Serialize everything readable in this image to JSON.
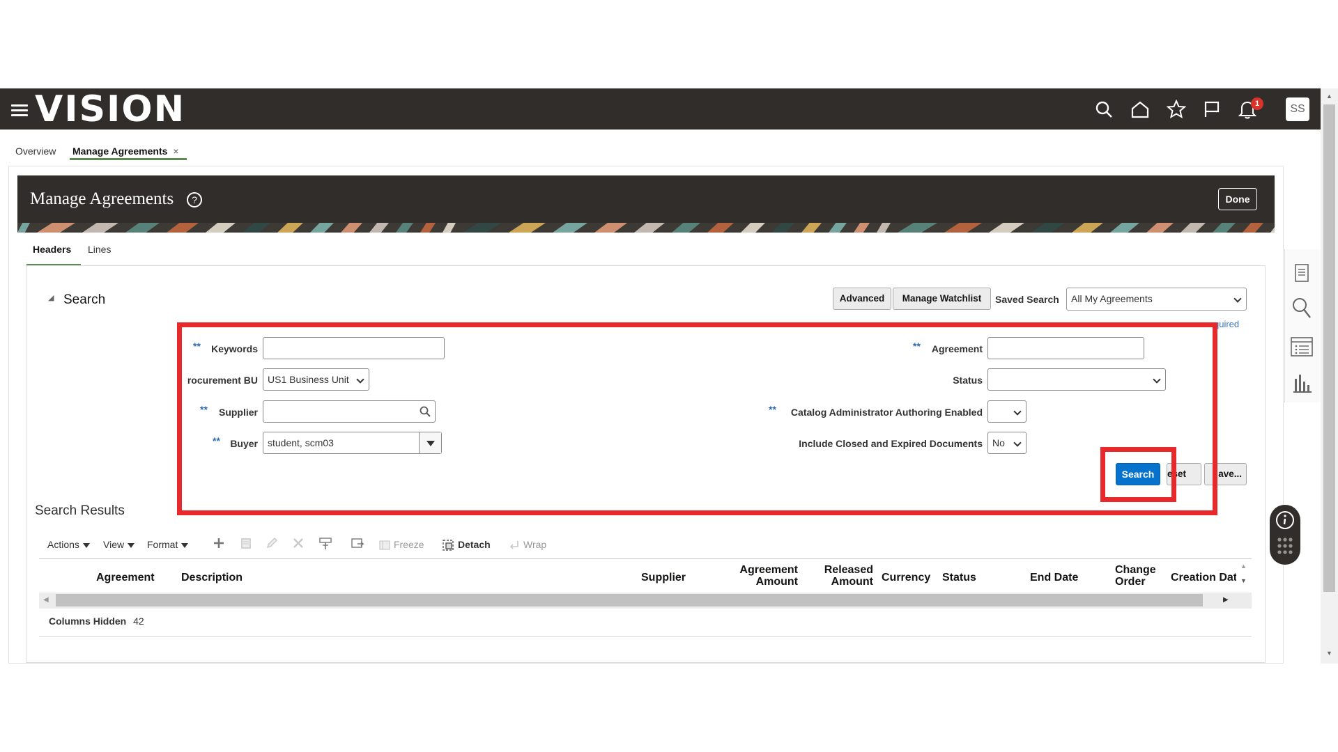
{
  "header": {
    "logo": "VISION",
    "notification_count": "1",
    "avatar_initials": "SS",
    "icons": [
      "search-icon",
      "home-icon",
      "star-icon",
      "flag-icon",
      "bell-icon"
    ]
  },
  "nav_tabs": {
    "overview": "Overview",
    "manage": "Manage Agreements",
    "close": "×"
  },
  "page": {
    "title": "Manage Agreements",
    "help": "?",
    "done": "Done"
  },
  "sub_tabs": {
    "headers": "Headers",
    "lines": "Lines"
  },
  "search": {
    "title": "Search",
    "advanced": "Advanced",
    "watchlist": "Manage Watchlist",
    "saved_search_label": "Saved Search",
    "saved_search_value": "All My Agreements",
    "required": "quired",
    "fields": {
      "keywords_label": "Keywords",
      "keywords_value": "",
      "procurement_bu_label": "rocurement BU",
      "procurement_bu_value": "US1 Business Unit",
      "supplier_label": "Supplier",
      "supplier_value": "",
      "buyer_label": "Buyer",
      "buyer_value": "student, scm03",
      "agreement_label": "Agreement",
      "agreement_value": "",
      "status_label": "Status",
      "status_value": "",
      "catalog_label": "Catalog Administrator Authoring Enabled",
      "catalog_value": "",
      "include_closed_label": "Include Closed and Expired Documents",
      "include_closed_value": "No",
      "required_marker": "**"
    },
    "buttons": {
      "search": "Search",
      "reset": "eset",
      "save": "ave..."
    }
  },
  "results": {
    "title": "Search Results",
    "toolbar": {
      "actions": "Actions",
      "view": "View",
      "format": "Format",
      "freeze": "Freeze",
      "detach": "Detach",
      "wrap": "Wrap"
    },
    "columns": [
      "Agreement",
      "Description",
      "Supplier",
      "Agreement Amount",
      "Released Amount",
      "Currency",
      "Status",
      "End Date",
      "Change Order",
      "Creation Dat"
    ],
    "hidden_label": "Columns Hidden",
    "hidden_count": "42"
  },
  "colors": {
    "header_bg": "#312d2a",
    "accent_green": "#5d8a53",
    "primary_blue": "#0572ce",
    "highlight_red": "#e8292b"
  }
}
